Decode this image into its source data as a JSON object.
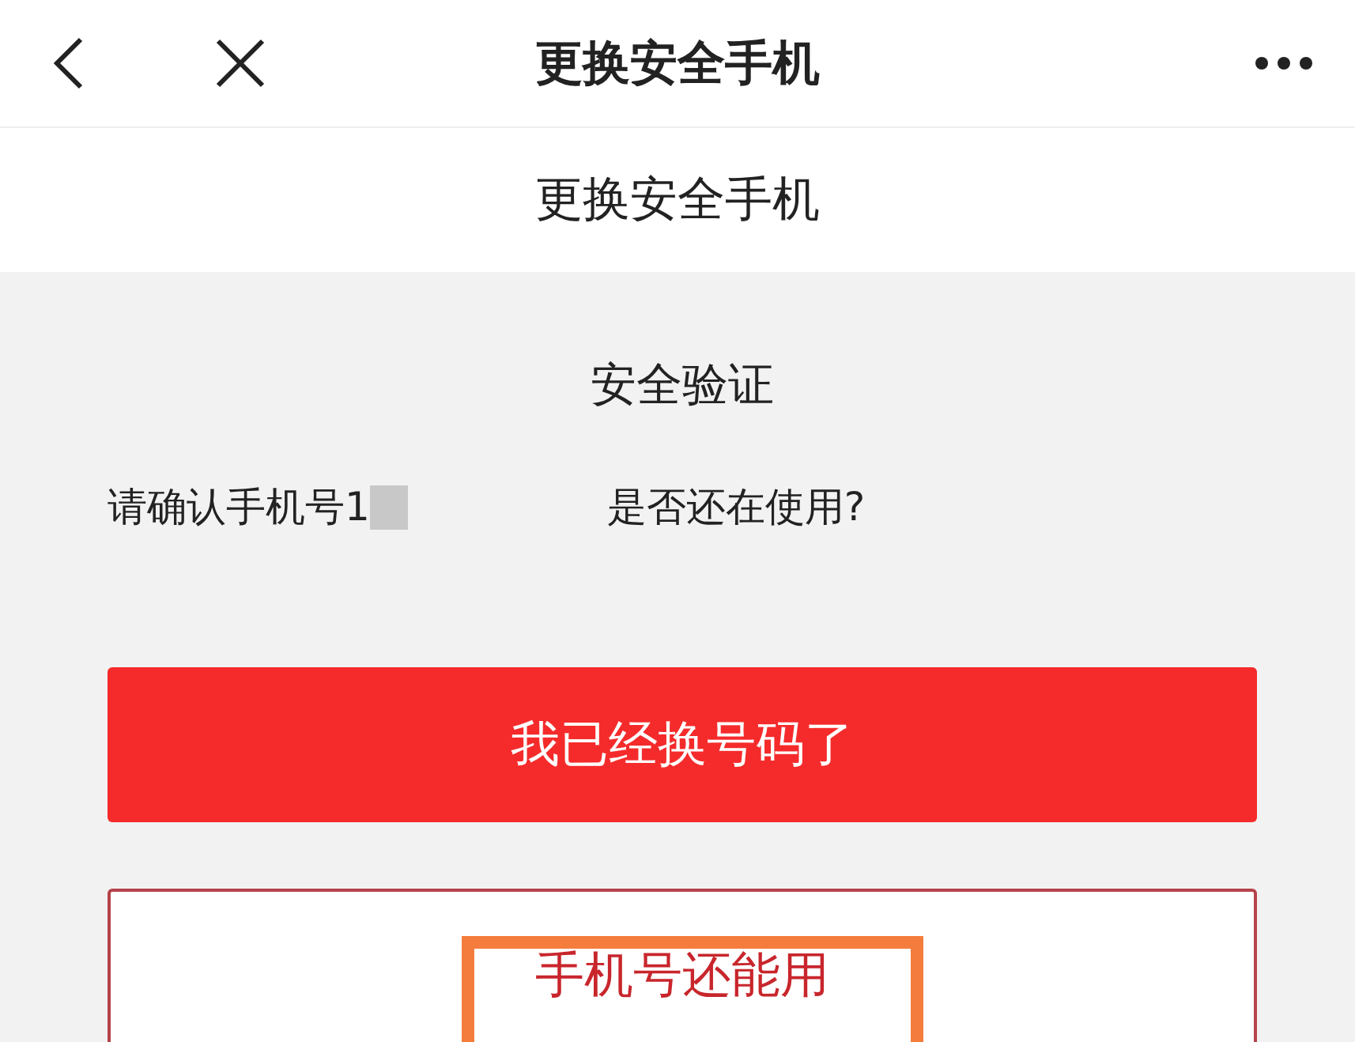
{
  "nav_bar": {
    "title": "更换安全手机"
  },
  "header": {
    "title": "更换安全手机"
  },
  "verification": {
    "title": "安全验证",
    "question_start": "请确认手机号1",
    "question_end": "是否还在使用?"
  },
  "buttons": [
    {
      "label": "我已经换号码了",
      "kind": "primary",
      "highlighted": false
    },
    {
      "label": "手机号还能用",
      "kind": "outline",
      "highlighted": true
    }
  ]
}
